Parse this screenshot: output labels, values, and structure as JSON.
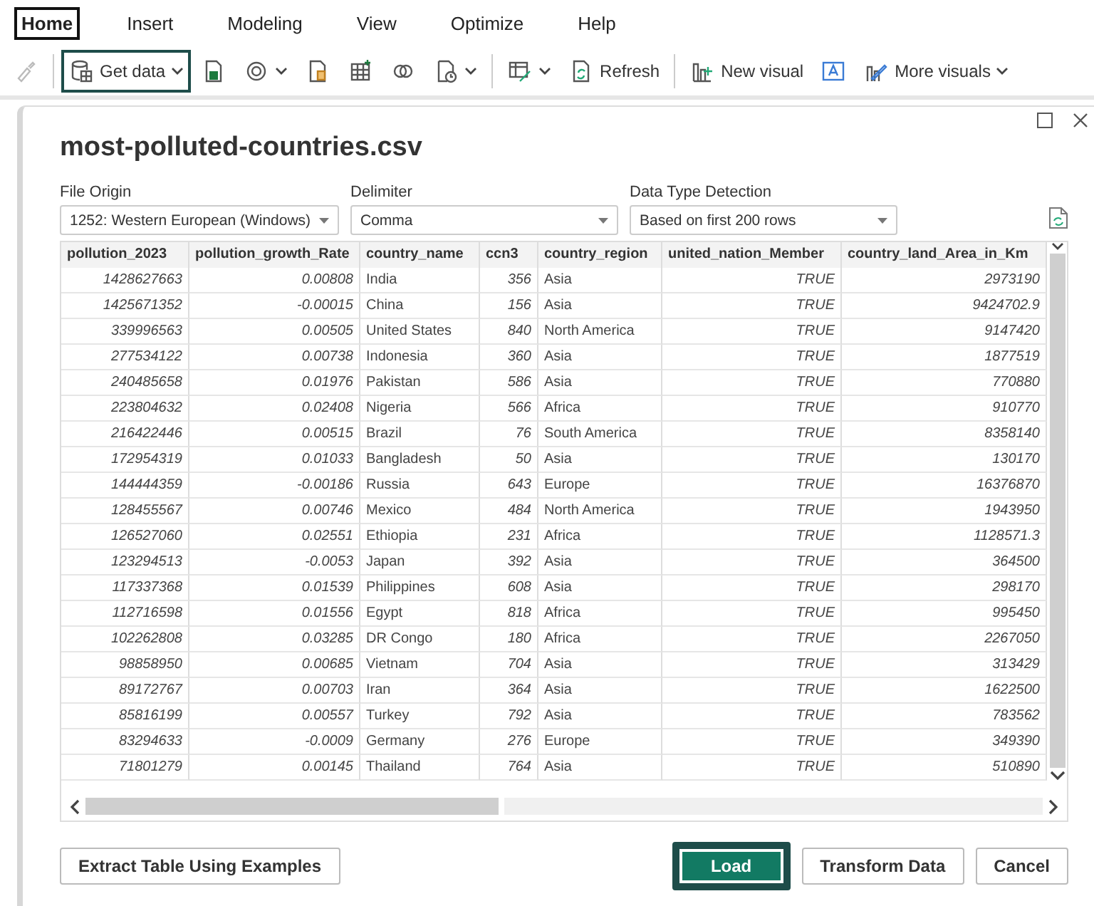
{
  "menu_tabs": [
    {
      "label": "Home",
      "selected": true
    },
    {
      "label": "Insert",
      "selected": false
    },
    {
      "label": "Modeling",
      "selected": false
    },
    {
      "label": "View",
      "selected": false
    },
    {
      "label": "Optimize",
      "selected": false
    },
    {
      "label": "Help",
      "selected": false
    }
  ],
  "toolbar": [
    {
      "kind": "brush"
    },
    {
      "kind": "getdata",
      "label": "Get data",
      "highlighted": true
    },
    {
      "kind": "excel"
    },
    {
      "kind": "hub"
    },
    {
      "kind": "clipboard"
    },
    {
      "kind": "table"
    },
    {
      "kind": "dataverse"
    },
    {
      "kind": "recent"
    },
    {
      "kind": "transform"
    },
    {
      "kind": "refresh",
      "label": "Refresh"
    },
    {
      "kind": "newvisual",
      "label": "New visual"
    },
    {
      "kind": "textbox"
    },
    {
      "kind": "morevisuals",
      "label": "More visuals"
    }
  ],
  "dialog": {
    "title": "most-polluted-countries.csv",
    "options": [
      {
        "label": "File Origin",
        "value": "1252: Western European (Windows)"
      },
      {
        "label": "Delimiter",
        "value": "Comma"
      },
      {
        "label": "Data Type Detection",
        "value": "Based on first 200 rows"
      }
    ],
    "table": {
      "columns": [
        {
          "label": "pollution_2023",
          "kind": "number"
        },
        {
          "label": "pollution_growth_Rate",
          "kind": "number"
        },
        {
          "label": "country_name",
          "kind": "text"
        },
        {
          "label": "ccn3",
          "kind": "number"
        },
        {
          "label": "country_region",
          "kind": "text"
        },
        {
          "label": "united_nation_Member",
          "kind": "number"
        },
        {
          "label": "country_land_Area_in_Km",
          "kind": "number"
        }
      ],
      "rows": [
        [
          "1428627663",
          "0.00808",
          "India",
          "356",
          "Asia",
          "TRUE",
          "2973190"
        ],
        [
          "1425671352",
          "-0.00015",
          "China",
          "156",
          "Asia",
          "TRUE",
          "9424702.9"
        ],
        [
          "339996563",
          "0.00505",
          "United States",
          "840",
          "North America",
          "TRUE",
          "9147420"
        ],
        [
          "277534122",
          "0.00738",
          "Indonesia",
          "360",
          "Asia",
          "TRUE",
          "1877519"
        ],
        [
          "240485658",
          "0.01976",
          "Pakistan",
          "586",
          "Asia",
          "TRUE",
          "770880"
        ],
        [
          "223804632",
          "0.02408",
          "Nigeria",
          "566",
          "Africa",
          "TRUE",
          "910770"
        ],
        [
          "216422446",
          "0.00515",
          "Brazil",
          "76",
          "South America",
          "TRUE",
          "8358140"
        ],
        [
          "172954319",
          "0.01033",
          "Bangladesh",
          "50",
          "Asia",
          "TRUE",
          "130170"
        ],
        [
          "144444359",
          "-0.00186",
          "Russia",
          "643",
          "Europe",
          "TRUE",
          "16376870"
        ],
        [
          "128455567",
          "0.00746",
          "Mexico",
          "484",
          "North America",
          "TRUE",
          "1943950"
        ],
        [
          "126527060",
          "0.02551",
          "Ethiopia",
          "231",
          "Africa",
          "TRUE",
          "1128571.3"
        ],
        [
          "123294513",
          "-0.0053",
          "Japan",
          "392",
          "Asia",
          "TRUE",
          "364500"
        ],
        [
          "117337368",
          "0.01539",
          "Philippines",
          "608",
          "Asia",
          "TRUE",
          "298170"
        ],
        [
          "112716598",
          "0.01556",
          "Egypt",
          "818",
          "Africa",
          "TRUE",
          "995450"
        ],
        [
          "102262808",
          "0.03285",
          "DR Congo",
          "180",
          "Africa",
          "TRUE",
          "2267050"
        ],
        [
          "98858950",
          "0.00685",
          "Vietnam",
          "704",
          "Asia",
          "TRUE",
          "313429"
        ],
        [
          "89172767",
          "0.00703",
          "Iran",
          "364",
          "Asia",
          "TRUE",
          "1622500"
        ],
        [
          "85816199",
          "0.00557",
          "Turkey",
          "792",
          "Asia",
          "TRUE",
          "783562"
        ],
        [
          "83294633",
          "-0.0009",
          "Germany",
          "276",
          "Europe",
          "TRUE",
          "349390"
        ],
        [
          "71801279",
          "0.00145",
          "Thailand",
          "764",
          "Asia",
          "TRUE",
          "510890"
        ]
      ]
    },
    "buttons": [
      {
        "label": "Extract Table Using Examples",
        "kind": "secondary"
      },
      {
        "label": "Load",
        "kind": "primary"
      },
      {
        "label": "Transform Data",
        "kind": "secondary"
      },
      {
        "label": "Cancel",
        "kind": "secondary"
      }
    ]
  }
}
